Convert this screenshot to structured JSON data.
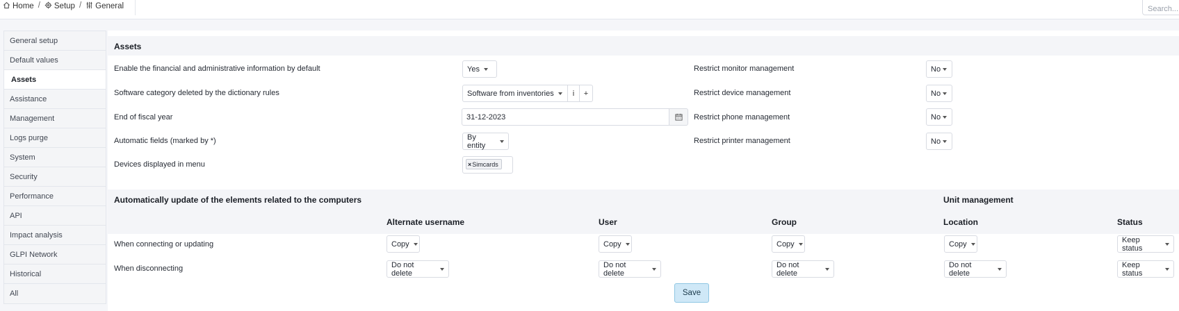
{
  "breadcrumb": {
    "home": "Home",
    "setup": "Setup",
    "general": "General",
    "separator": "/"
  },
  "search": {
    "placeholder": "Search..."
  },
  "sidebar": {
    "items": [
      {
        "label": "General setup"
      },
      {
        "label": "Default values"
      },
      {
        "label": "Assets"
      },
      {
        "label": "Assistance"
      },
      {
        "label": "Management"
      },
      {
        "label": "Logs purge"
      },
      {
        "label": "System"
      },
      {
        "label": "Security"
      },
      {
        "label": "Performance"
      },
      {
        "label": "API"
      },
      {
        "label": "Impact analysis"
      },
      {
        "label": "GLPI Network"
      },
      {
        "label": "Historical"
      },
      {
        "label": "All"
      }
    ],
    "active": "Assets"
  },
  "assets": {
    "title": "Assets",
    "financial_label": "Enable the financial and administrative information by default",
    "financial_value": "Yes",
    "software_label": "Software category deleted by the dictionary rules",
    "software_value": "Software from inventories",
    "software_info": "i",
    "software_add": "+",
    "fiscal_label": "End of fiscal year",
    "fiscal_value": "31-12-2023",
    "auto_label": "Automatic fields (marked by *)",
    "auto_value": "By entity",
    "devices_label": "Devices displayed in menu",
    "devices_tag": "Simcards",
    "devices_tag_remove": "×",
    "monitor_label": "Restrict monitor management",
    "monitor_value": "No",
    "device_label": "Restrict device management",
    "device_value": "No",
    "phone_label": "Restrict phone management",
    "phone_value": "No",
    "printer_label": "Restrict printer management",
    "printer_value": "No"
  },
  "auto_update": {
    "title": "Automatically update of the elements related to the computers",
    "unit_title": "Unit management",
    "columns": [
      "Alternate username",
      "User",
      "Group",
      "Location",
      "Status"
    ],
    "rows": [
      {
        "label": "When connecting or updating",
        "values": [
          "Copy",
          "Copy",
          "Copy",
          "Copy",
          "Keep status"
        ]
      },
      {
        "label": "When disconnecting",
        "values": [
          "Do not delete",
          "Do not delete",
          "Do not delete",
          "Do not delete",
          "Keep status"
        ]
      }
    ]
  },
  "save_label": "Save",
  "colors": {
    "accent": "#cfe8f7",
    "border": "#d8dbe2",
    "band": "#f4f5f8"
  }
}
